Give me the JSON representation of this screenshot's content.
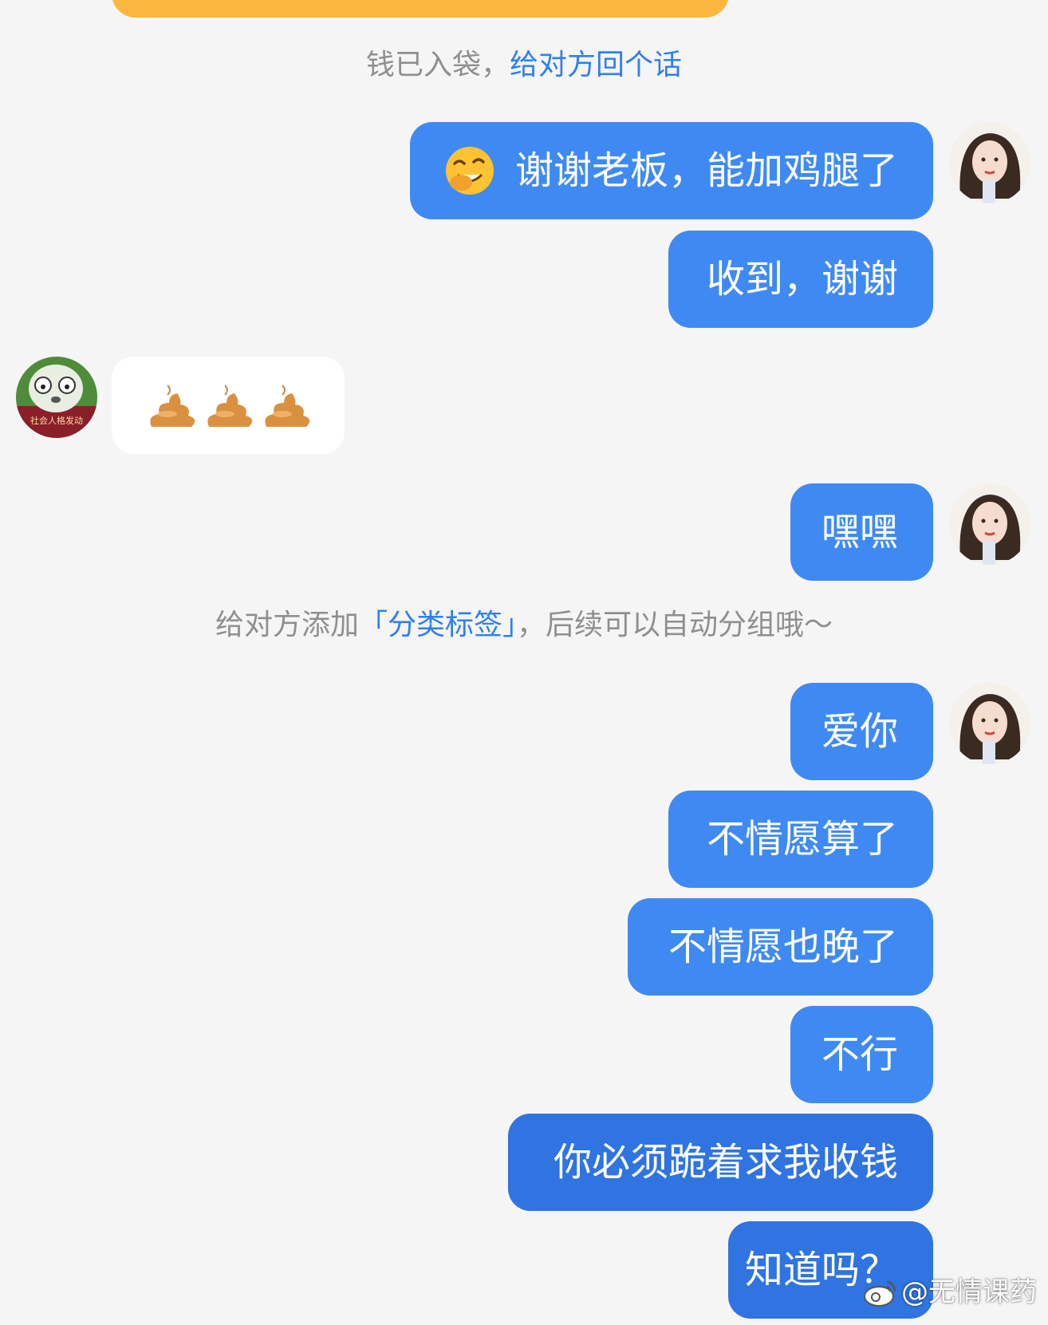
{
  "system_notices": {
    "received": {
      "text": "钱已入袋，",
      "link": "给对方回个话"
    },
    "tag_hint": {
      "prefix": "给对方添加",
      "link": "「分类标签」",
      "suffix": "，后续可以自动分组哦～"
    }
  },
  "messages": [
    {
      "side": "right",
      "text": "谢谢老板，能加鸡腿了",
      "emoji": "covering-mouth-emoji"
    },
    {
      "side": "right",
      "text": "收到，谢谢"
    },
    {
      "side": "left",
      "emoji": "poop-emoji",
      "count": 3
    },
    {
      "side": "right",
      "text": "嘿嘿"
    },
    {
      "side": "right",
      "text": "爱你"
    },
    {
      "side": "right",
      "text": "不情愿算了"
    },
    {
      "side": "right",
      "text": "不情愿也晚了"
    },
    {
      "side": "right",
      "text": "不行"
    },
    {
      "side": "right",
      "text": "你必须跪着求我收钱"
    },
    {
      "side": "right",
      "text": "知道吗？"
    }
  ],
  "avatars": {
    "other_badge_text": "社会人格发动"
  },
  "watermark": "@无情课药",
  "colors": {
    "background": "#f5f5f5",
    "bubble_blue": "#3f8af2",
    "bubble_blue_dark": "#2f74e0",
    "link_blue": "#2f7ff0",
    "system_gray": "#8f8f8f",
    "transfer_orange": "#fbb63f"
  }
}
